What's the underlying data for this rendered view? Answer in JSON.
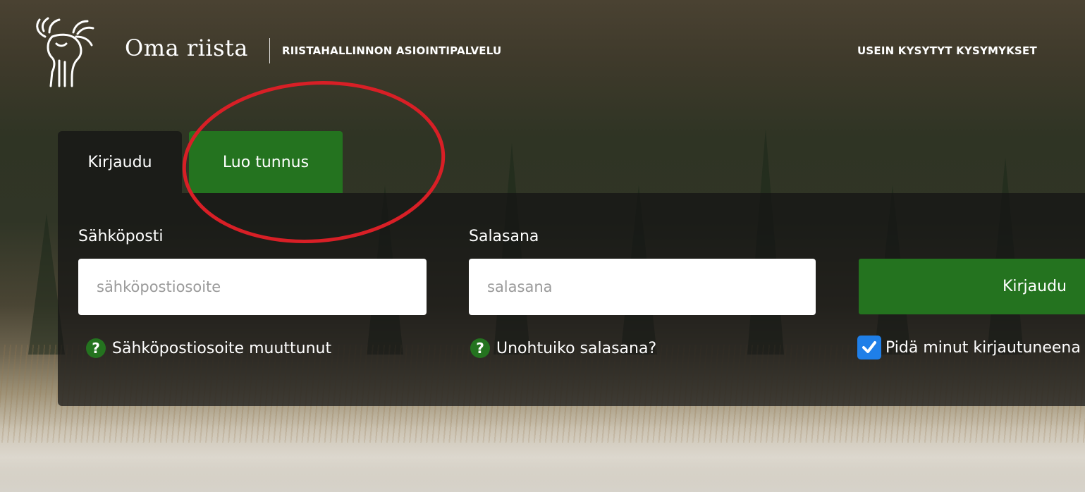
{
  "header": {
    "brand": "Oma riista",
    "subtitle": "RIISTAHALLINNON ASIOINTIPALVELU",
    "faq_link": "USEIN KYSYTYT KYSYMYKSET"
  },
  "tabs": [
    {
      "label": "Kirjaudu",
      "active": true
    },
    {
      "label": "Luo tunnus",
      "active": false
    }
  ],
  "form": {
    "email": {
      "label": "Sähköposti",
      "placeholder": "sähköpostiosoite",
      "value": ""
    },
    "password": {
      "label": "Salasana",
      "placeholder": "salasana",
      "value": ""
    },
    "email_help": "Sähköpostiosoite muuttunut",
    "password_help": "Unohtuiko salasana?",
    "help_icon_glyph": "?",
    "submit_label": "Kirjaudu",
    "remember_label": "Pidä minut kirjautuneena",
    "remember_checked": true
  },
  "colors": {
    "accent_green": "#24731f",
    "checkbox_blue": "#1f7fe8",
    "annotation_red": "#d81f26"
  },
  "icons": {
    "logo": "moose-logo-icon",
    "help": "question-circle-icon",
    "check": "checkmark-icon"
  }
}
